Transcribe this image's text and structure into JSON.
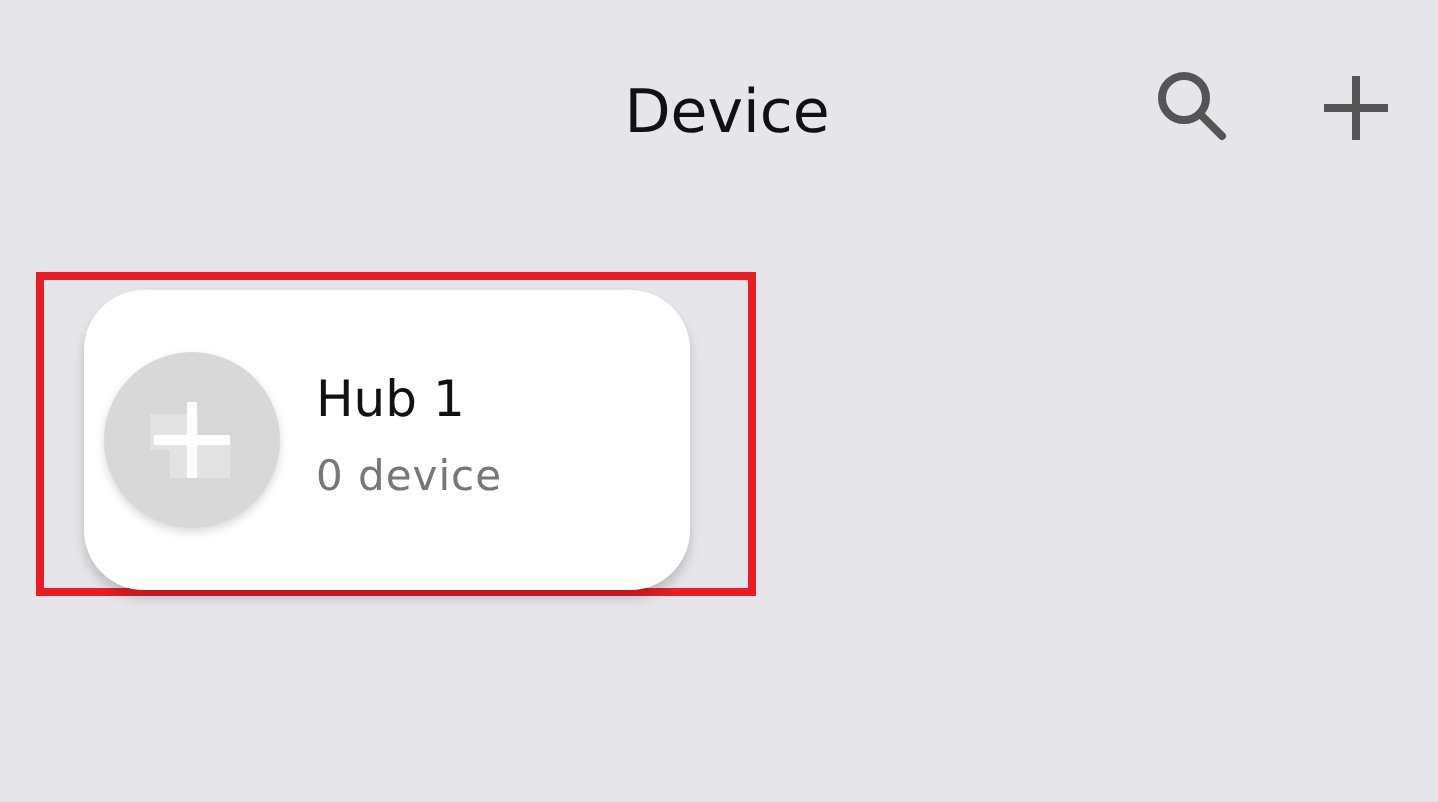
{
  "header": {
    "title": "Device"
  },
  "hubs": [
    {
      "name": "Hub 1",
      "count": "0 device",
      "highlighted": true
    }
  ]
}
